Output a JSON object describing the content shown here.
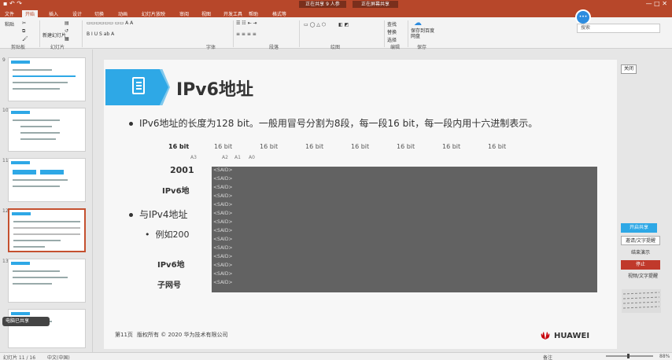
{
  "titlebar": {
    "doc_badge": "正在共享 9 人参",
    "ctrl_badge": "正在屏幕共享",
    "window_controls": "—  □  ✕"
  },
  "tabs": [
    "文件",
    "开始",
    "插入",
    "设计",
    "切换",
    "动画",
    "幻灯片放映",
    "审阅",
    "视图",
    "开发工具",
    "帮助",
    "格式等"
  ],
  "ribbon": {
    "paste": "粘贴",
    "new_slide": "新建幻灯片",
    "groups": [
      "剪贴板",
      "幻灯片",
      "字体",
      "段落",
      "绘图",
      "编辑",
      "保存"
    ],
    "find": "查找",
    "replace": "替换",
    "select": "选择",
    "save_button": "保存到百度网盘",
    "share_search": "搜索"
  },
  "thumbnails": [
    {
      "num": "9"
    },
    {
      "num": "10"
    },
    {
      "num": "11"
    },
    {
      "num": "12"
    },
    {
      "num": "13"
    }
  ],
  "presenter_chip": "电脑已共享",
  "slide": {
    "title": "IPv6地址",
    "bullet1": "IPv6地址的长度为128 bit。一般用冒号分割为8段，每一段16 bit，每一段内用十六进制表示。",
    "bit_first": "16 bit",
    "bits": [
      "16 bit",
      "16 bit",
      "16 bit",
      "16 bit",
      "16 bit",
      "16 bit",
      "16 bit"
    ],
    "small_labels": [
      "A3",
      "A2",
      "A1",
      "A0"
    ],
    "prefix_2001": "2001",
    "ipv6_label_1": "IPv6地",
    "bullet2": "与IPv4地址",
    "example": "例如200",
    "ipv6_label_2": "IPv6地",
    "subnet_label": "子网号",
    "overlay_lines": [
      "<SAID>",
      "<SAID>",
      "<SAID>",
      "<SAID>",
      "<SAID>",
      "<SAID>",
      "<SAID>",
      "<SAID>",
      "<SAID>",
      "<SAID>",
      "<SAID>",
      "<SAID>",
      "<SAID>",
      "<SAID>"
    ],
    "page_no": "第11页",
    "copyright": "版权所有 © 2020 华为技术有限公司",
    "brand": "HUAWEI"
  },
  "side_panel": {
    "close": "关闭",
    "btn_blue": "开启共享",
    "btn_white": "邀请/文字提醒",
    "btn_plain": "结束演示",
    "btn_red": "停止",
    "btn_text": "视频/文字提醒"
  },
  "status": {
    "left": "幻灯片 11 / 16",
    "lang": "中文(中国)",
    "notes": "备注",
    "zoom": "88%"
  },
  "colors": {
    "ppt_red": "#b7472a",
    "accent_blue": "#2ea8e6",
    "overlay_gray": "#626262",
    "panel_red": "#c0392b"
  }
}
